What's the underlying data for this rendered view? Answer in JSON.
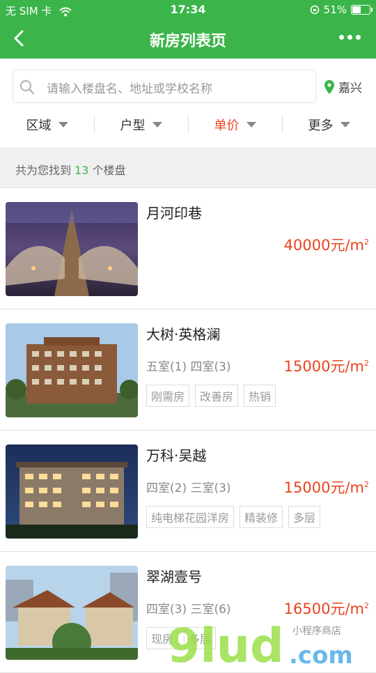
{
  "status": {
    "carrier": "无 SIM 卡",
    "time": "17:34",
    "battery": "51%",
    "battery_level": 0.51
  },
  "nav": {
    "title": "新房列表页"
  },
  "search": {
    "placeholder": "请输入楼盘名、地址或学校名称",
    "city": "嘉兴"
  },
  "filters": [
    {
      "label": "区域",
      "active": false
    },
    {
      "label": "户型",
      "active": false
    },
    {
      "label": "单价",
      "active": true
    },
    {
      "label": "更多",
      "active": false
    }
  ],
  "summary": {
    "prefix": "共为您找到",
    "count": "13",
    "suffix": "个楼盘"
  },
  "listings": [
    {
      "name": "月河印巷",
      "rooms": "",
      "price": "40000元/m",
      "unit_sup": "2",
      "tags": []
    },
    {
      "name": "大树·英格澜",
      "rooms": "五室(1) 四室(3)",
      "price": "15000元/m",
      "unit_sup": "2",
      "tags": [
        "刚需房",
        "改善房",
        "热销"
      ]
    },
    {
      "name": "万科·吴越",
      "rooms": "四室(2) 三室(3)",
      "price": "15000元/m",
      "unit_sup": "2",
      "tags": [
        "纯电梯花园洋房",
        "精装修",
        "多层"
      ]
    },
    {
      "name": "翠湖壹号",
      "rooms": "四室(3) 三室(6)",
      "price": "16500元/m",
      "unit_sup": "2",
      "tags": [
        "现房",
        "多层"
      ]
    }
  ],
  "colors": {
    "brand": "#3bb54a",
    "price": "#e8431e"
  },
  "icons": [
    "back-arrow-icon",
    "more-dots-icon",
    "search-icon",
    "location-pin-icon",
    "caret-down-icon"
  ],
  "watermark": {
    "text1": "9lud",
    "text2": ".com",
    "text3": "小程序商店"
  }
}
